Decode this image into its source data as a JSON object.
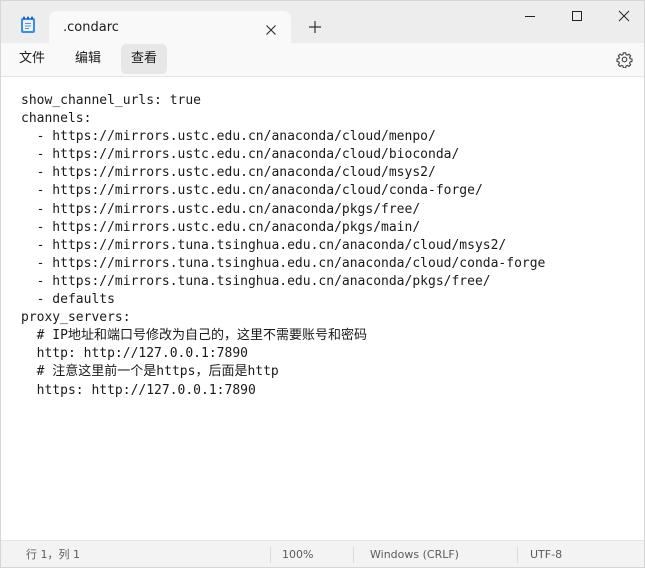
{
  "app": {
    "icon": "notepad-icon"
  },
  "tab": {
    "title": ".condarc",
    "close_icon": "close-icon"
  },
  "new_tab_icon": "plus-icon",
  "window_controls": {
    "minimize_icon": "minimize-icon",
    "maximize_icon": "maximize-icon",
    "close_icon": "close-icon"
  },
  "menu": {
    "file": "文件",
    "edit": "编辑",
    "view": "查看",
    "settings_icon": "gear-icon"
  },
  "editor": {
    "lines": [
      "show_channel_urls: true",
      "channels:",
      "  - https://mirrors.ustc.edu.cn/anaconda/cloud/menpo/",
      "  - https://mirrors.ustc.edu.cn/anaconda/cloud/bioconda/",
      "  - https://mirrors.ustc.edu.cn/anaconda/cloud/msys2/",
      "  - https://mirrors.ustc.edu.cn/anaconda/cloud/conda-forge/",
      "  - https://mirrors.ustc.edu.cn/anaconda/pkgs/free/",
      "  - https://mirrors.ustc.edu.cn/anaconda/pkgs/main/",
      "  - https://mirrors.tuna.tsinghua.edu.cn/anaconda/cloud/msys2/",
      "  - https://mirrors.tuna.tsinghua.edu.cn/anaconda/cloud/conda-forge",
      "  - https://mirrors.tuna.tsinghua.edu.cn/anaconda/pkgs/free/",
      "  - defaults",
      "proxy_servers:",
      "  # IP地址和端口号修改为自己的，这里不需要账号和密码",
      "  http: http://127.0.0.1:7890",
      "  # 注意这里前一个是https，后面是http",
      "  https: http://127.0.0.1:7890"
    ]
  },
  "status": {
    "position": "行 1，列 1",
    "zoom": "100%",
    "line_ending": "Windows (CRLF)",
    "encoding": "UTF-8"
  }
}
